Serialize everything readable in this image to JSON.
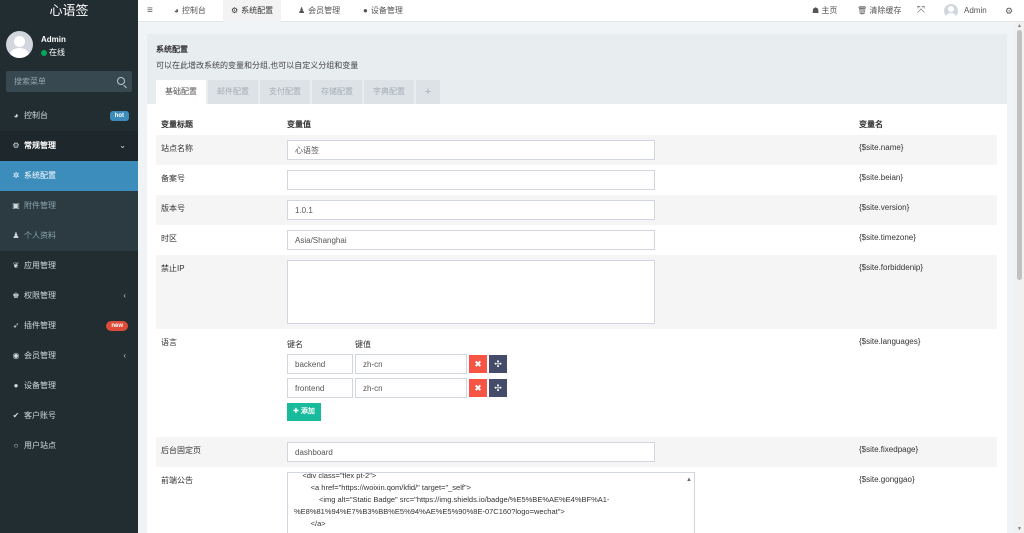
{
  "brand": "心语签",
  "user": {
    "name": "Admin",
    "status": "在线"
  },
  "search": {
    "placeholder": "搜索菜单"
  },
  "menu": {
    "dashboard": "控制台",
    "dashboard_badge": "hot",
    "general": "常规管理",
    "config": "系统配置",
    "attachment": "附件管理",
    "profile": "个人资料",
    "apps": "应用管理",
    "auth": "权限管理",
    "plugins": "插件管理",
    "plugins_badge": "new",
    "members": "会员管理",
    "devices": "设备管理",
    "accounts": "客户账号",
    "sites": "用户站点"
  },
  "topbar": {
    "tabs": [
      "控制台",
      "系统配置",
      "会员管理",
      "设备管理"
    ],
    "home": "主页",
    "clear_cache": "清除缓存",
    "admin": "Admin"
  },
  "panel": {
    "title": "系统配置",
    "description": "可以在此增改系统的变量和分组,也可以自定义分组和变量",
    "tabs": [
      "基础配置",
      "邮件配置",
      "支付配置",
      "存储配置",
      "字典配置"
    ],
    "add_tab": "+"
  },
  "columns": {
    "title": "变量标题",
    "value": "变量值",
    "name": "变量名"
  },
  "rows": {
    "sitename": {
      "label": "站点名称",
      "value": "心语签",
      "var": "{$site.name}"
    },
    "beian": {
      "label": "备案号",
      "value": "",
      "var": "{$site.beian}"
    },
    "version": {
      "label": "版本号",
      "value": "1.0.1",
      "var": "{$site.version}"
    },
    "timezone": {
      "label": "时区",
      "value": "Asia/Shanghai",
      "var": "{$site.timezone}"
    },
    "forbiddenip": {
      "label": "禁止IP",
      "value": "",
      "var": "{$site.forbiddenip}"
    },
    "languages": {
      "label": "语言",
      "var": "{$site.languages}",
      "key_header": "键名",
      "value_header": "键值",
      "items": [
        {
          "key": "backend",
          "value": "zh-cn"
        },
        {
          "key": "frontend",
          "value": "zh-cn"
        }
      ],
      "add_label": "添加"
    },
    "fixedpage": {
      "label": "后台固定页",
      "value": "dashboard",
      "var": "{$site.fixedpage}"
    },
    "gonggao": {
      "label": "前端公告",
      "var": "{$site.gonggao}",
      "code_lines": [
        "    <div class=\"flex pt-2\">",
        "        <a href=\"https://woixin.qom/kfid/\" target=\"_self\">",
        "            <img alt=\"Static Badge\" src=\"https://img.shields.io/badge/%E5%BE%AE%E4%BF%A1-",
        "%E8%81%94%E7%B3%BB%E5%94%AE%E5%90%8E-07C160?logo=wechat\">",
        "        </a>"
      ]
    }
  },
  "icons": {
    "menu_toggle": "bars-icon",
    "dashboard": "dashboard-icon",
    "general": "cogs-icon",
    "config": "cog-icon",
    "attachment": "file-image-icon",
    "profile": "user-icon",
    "apps": "leaf-icon",
    "auth": "group-icon",
    "plugins": "rocket-icon",
    "members": "user-circle-icon",
    "devices": "gear-circle-icon",
    "accounts": "check-circle-icon",
    "sites": "circle-icon"
  },
  "colors": {
    "sidebar": "#222d32",
    "active": "#3c8dbc",
    "hot": "#3c8dbc",
    "new": "#dd4b39",
    "delete": "#f75444",
    "move": "#444c69",
    "add": "#18bc9c",
    "online": "#00a65a"
  }
}
